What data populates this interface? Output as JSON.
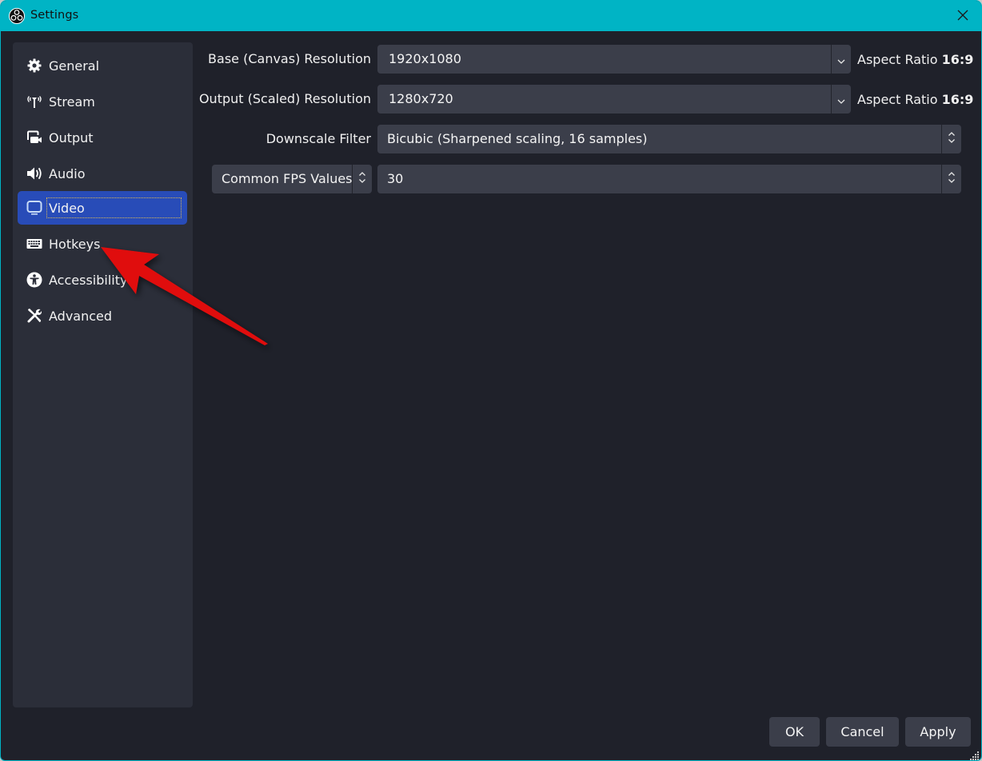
{
  "window": {
    "title": "Settings",
    "app_icon": "obs-logo-icon",
    "close_icon": "close-icon"
  },
  "sidebar": {
    "items": [
      {
        "label": "General",
        "icon": "gear-icon",
        "active": false
      },
      {
        "label": "Stream",
        "icon": "antenna-icon",
        "active": false
      },
      {
        "label": "Output",
        "icon": "output-camera-icon",
        "active": false
      },
      {
        "label": "Audio",
        "icon": "speaker-icon",
        "active": false
      },
      {
        "label": "Video",
        "icon": "monitor-icon",
        "active": true
      },
      {
        "label": "Hotkeys",
        "icon": "keyboard-icon",
        "active": false
      },
      {
        "label": "Accessibility",
        "icon": "accessibility-icon",
        "active": false
      },
      {
        "label": "Advanced",
        "icon": "tools-icon",
        "active": false
      }
    ]
  },
  "video": {
    "base_resolution": {
      "label": "Base (Canvas) Resolution",
      "value": "1920x1080",
      "aspect_label": "Aspect Ratio",
      "aspect_value": "16:9"
    },
    "output_resolution": {
      "label": "Output (Scaled) Resolution",
      "value": "1280x720",
      "aspect_label": "Aspect Ratio",
      "aspect_value": "16:9"
    },
    "downscale_filter": {
      "label": "Downscale Filter",
      "value": "Bicubic (Sharpened scaling, 16 samples)"
    },
    "fps": {
      "type_value": "Common FPS Values",
      "value": "30"
    }
  },
  "footer": {
    "ok_label": "OK",
    "cancel_label": "Cancel",
    "apply_label": "Apply"
  },
  "annotation": {
    "arrow_color": "#e00b0b",
    "points_to": "Hotkeys"
  },
  "colors": {
    "titlebar": "#00b4c5",
    "background": "#1f212a",
    "sidebar": "#2b2e39",
    "selected": "#284cb8",
    "control": "#3b3e4a"
  }
}
